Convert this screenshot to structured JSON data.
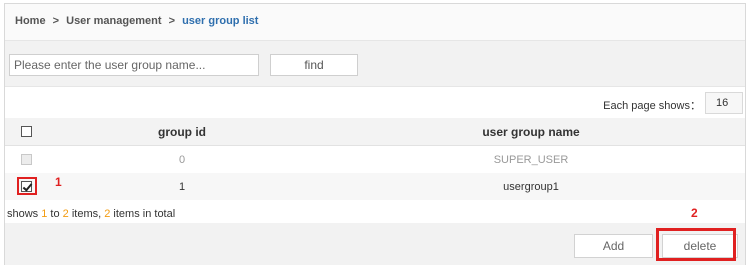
{
  "breadcrumb": {
    "home": "Home",
    "separator": ">",
    "section": "User management",
    "current": "user group list"
  },
  "search": {
    "placeholder": "Please enter the user group name...",
    "value": "",
    "find_label": "find"
  },
  "pagination": {
    "label": "Each page shows：",
    "page_size": "16"
  },
  "table": {
    "columns": [
      "group id",
      "user group name"
    ],
    "rows": [
      {
        "group_id": "0",
        "name": "SUPER_USER",
        "checked": false,
        "disabled": true
      },
      {
        "group_id": "1",
        "name": "usergroup1",
        "checked": true,
        "disabled": false
      }
    ]
  },
  "summary": {
    "prefix": "shows ",
    "from": "1",
    "to_word": " to ",
    "to": "2",
    "items_word": " items, ",
    "total": "2",
    "suffix": " items in total"
  },
  "actions": {
    "add_label": "Add",
    "delete_label": "delete"
  },
  "annotations": {
    "step1": "1",
    "step2": "2",
    "color": "#e02020"
  },
  "colors": {
    "link_blue": "#2f6fae",
    "count_orange": "#f39c12"
  }
}
